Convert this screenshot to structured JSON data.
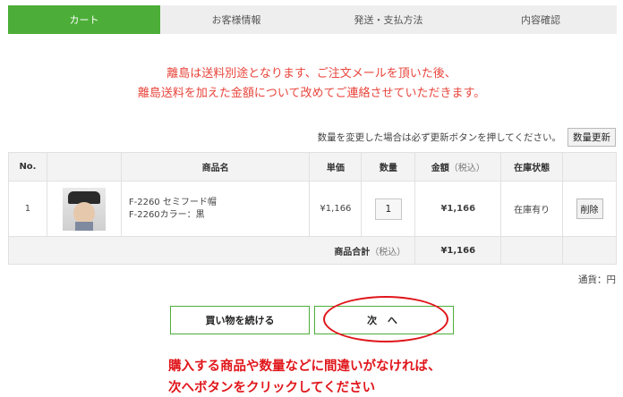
{
  "steps": [
    {
      "label": "カート",
      "active": true
    },
    {
      "label": "お客様情報",
      "active": false
    },
    {
      "label": "発送・支払方法",
      "active": false
    },
    {
      "label": "内容確認",
      "active": false
    }
  ],
  "notice": {
    "line1": "離島は送料別途となります、ご注文メールを頂いた後、",
    "line2": "離島送料を加えた金額について改めてご連絡させていただきます。"
  },
  "update": {
    "hint": "数量を変更した場合は必ず更新ボタンを押してください。",
    "button_label": "数量更新"
  },
  "table": {
    "headers": {
      "no": "No.",
      "image": "",
      "name": "商品名",
      "unit_price": "単価",
      "quantity": "数量",
      "amount": "金額",
      "amount_tax": "（税込）",
      "stock": "在庫状態",
      "action": ""
    },
    "rows": [
      {
        "no": "1",
        "name_line1": "F-2260 セミフード帽",
        "name_line2": "F-2260カラー：黒",
        "unit_price": "¥1,166",
        "quantity": "1",
        "amount": "¥1,166",
        "stock": "在庫有り",
        "delete_label": "削除"
      }
    ],
    "footer": {
      "label": "商品合計",
      "label_tax": "（税込）",
      "total": "¥1,166"
    }
  },
  "currency": "通貨：円",
  "buttons": {
    "continue_label": "買い物を続ける",
    "next_label": "次 へ"
  },
  "guide": {
    "line1": "購入する商品や数量などに間違いがなければ、",
    "line2": "次へボタンをクリックしてください"
  },
  "colors": {
    "accent_green": "#4cae38",
    "notice_red": "#e8453c",
    "price_red": "#e0161b"
  }
}
